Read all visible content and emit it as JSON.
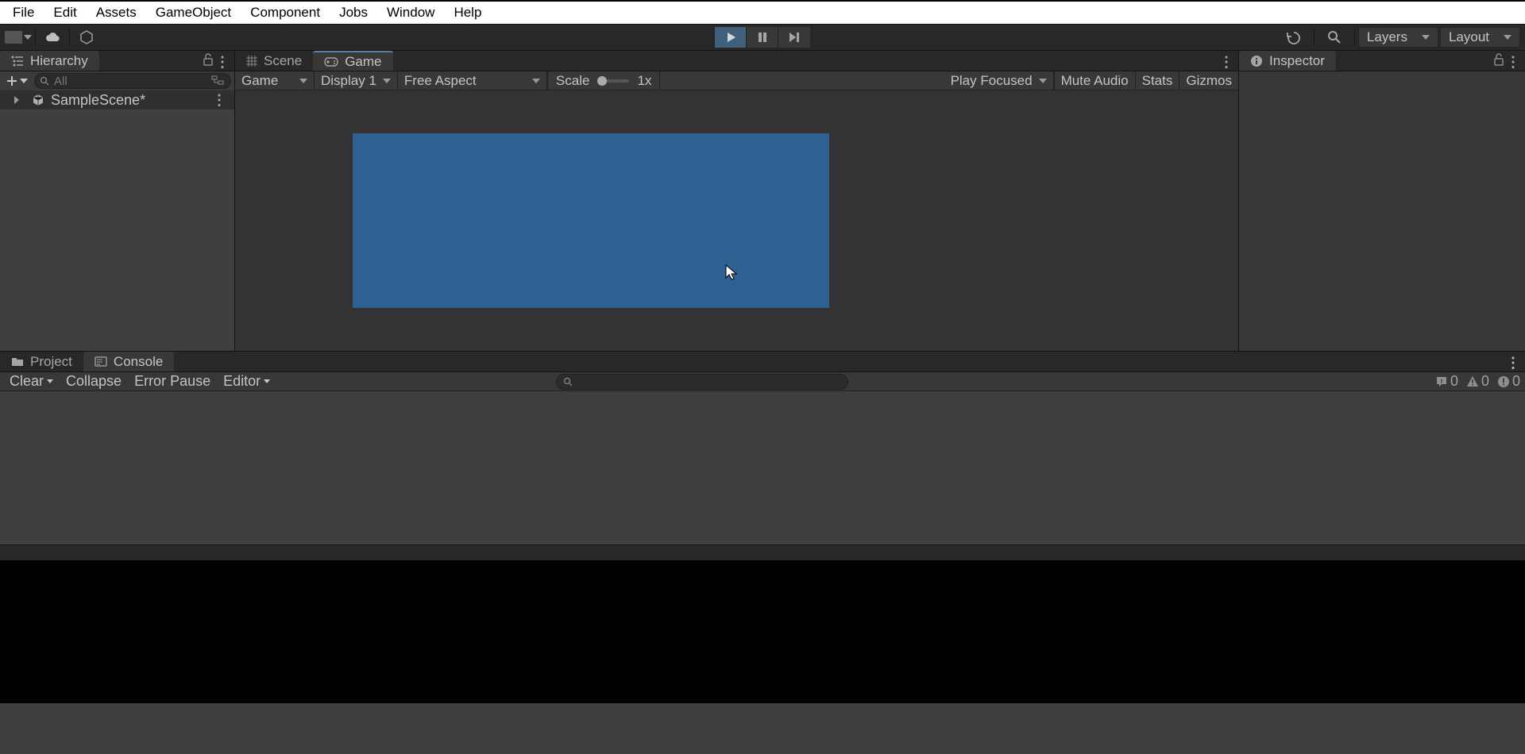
{
  "menu": {
    "items": [
      "File",
      "Edit",
      "Assets",
      "GameObject",
      "Component",
      "Jobs",
      "Window",
      "Help"
    ]
  },
  "toolbar": {
    "layers_label": "Layers",
    "layout_label": "Layout"
  },
  "hierarchy": {
    "tab_label": "Hierarchy",
    "search_placeholder": "All",
    "scene_name": "SampleScene*"
  },
  "scene_tab": {
    "label": "Scene"
  },
  "game_tab": {
    "label": "Game"
  },
  "game_toolbar": {
    "mode": "Game",
    "display": "Display 1",
    "aspect": "Free Aspect",
    "scale_label": "Scale",
    "scale_value": "1x",
    "play_focused": "Play Focused",
    "mute_audio": "Mute Audio",
    "stats": "Stats",
    "gizmos": "Gizmos"
  },
  "inspector": {
    "tab_label": "Inspector"
  },
  "project_tab": {
    "label": "Project"
  },
  "console_tab": {
    "label": "Console"
  },
  "console_toolbar": {
    "clear": "Clear",
    "collapse": "Collapse",
    "error_pause": "Error Pause",
    "editor": "Editor"
  },
  "counters": {
    "info": "0",
    "warning": "0",
    "error": "0"
  }
}
